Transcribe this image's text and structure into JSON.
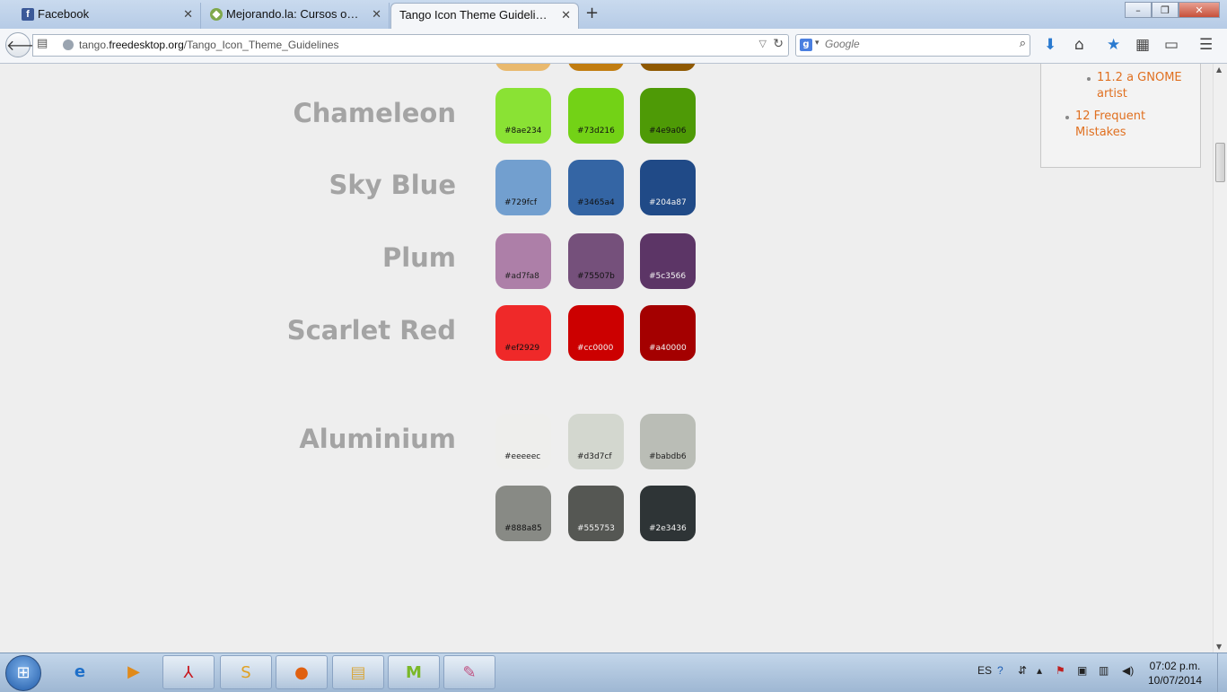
{
  "browser": {
    "tabs": [
      {
        "label": "Facebook",
        "icon": "facebook-icon",
        "active": false
      },
      {
        "label": "Mejorando.la: Cursos onlin...",
        "icon": "mejorandola-icon",
        "active": false
      },
      {
        "label": "Tango Icon Theme Guidelines ...",
        "icon": "tango-icon",
        "active": true
      }
    ],
    "new_tab_symbol": "+",
    "url": {
      "prefix": "tango.",
      "domain": "freedesktop.org",
      "path": "/Tango_Icon_Theme_Guidelines"
    },
    "search_placeholder": "Google"
  },
  "page": {
    "families": [
      {
        "name": "Chameleon",
        "swatches": [
          "#8ae234",
          "#73d216",
          "#4e9a06"
        ]
      },
      {
        "name": "Sky Blue",
        "swatches": [
          "#729fcf",
          "#3465a4",
          "#204a87"
        ]
      },
      {
        "name": "Plum",
        "swatches": [
          "#ad7fa8",
          "#75507b",
          "#5c3566"
        ]
      },
      {
        "name": "Scarlet Red",
        "swatches": [
          "#ef2929",
          "#cc0000",
          "#a40000"
        ]
      },
      {
        "name": "Aluminium",
        "swatches": [
          "#eeeeec",
          "#d3d7cf",
          "#babdb6",
          "#888a85",
          "#555753",
          "#2e3436"
        ]
      }
    ],
    "partial_top_swatch_colors": [
      "#e9b96e",
      "#c17d11",
      "#8f5902"
    ],
    "toc": {
      "item_11_1_tail": "artist",
      "item_11_2": "11.2 a GNOME artist",
      "item_11_2_line1": "11.2 a GNOME",
      "item_11_2_line2": "artist",
      "item_12_line1": "12 Frequent",
      "item_12_line2": "Mistakes"
    }
  },
  "taskbar": {
    "language": "ES",
    "time": "07:02 p.m.",
    "date": "10/07/2014"
  },
  "colors": {
    "heading_gray": "#a4a4a4",
    "link_orange": "#e07020",
    "page_bg": "#eeeeee"
  }
}
